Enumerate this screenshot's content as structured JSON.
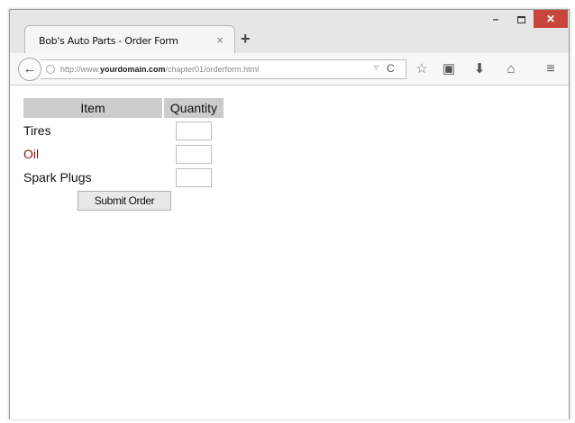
{
  "browser": {
    "tab_title": "Bob's Auto Parts - Order Form",
    "tab_close": "×",
    "new_tab": "+",
    "window_min": "–",
    "window_close": "✕",
    "back": "←",
    "url_prefix": "http://www.",
    "url_domain": "yourdomain.com",
    "url_path": "/chapter01/orderform.html",
    "reload": "C",
    "filter": "▿",
    "icons": {
      "star": "☆",
      "clipboard": "▣",
      "download": "⬇",
      "home": "⌂",
      "menu": "≡"
    }
  },
  "form": {
    "header_item": "Item",
    "header_quantity": "Quantity",
    "rows": [
      {
        "item": "Tires",
        "color": "#111111",
        "quantity": ""
      },
      {
        "item": "Oil",
        "color": "#7a1414",
        "quantity": ""
      },
      {
        "item": "Spark Plugs",
        "color": "#111111",
        "quantity": ""
      }
    ],
    "submit_label": "Submit Order"
  }
}
